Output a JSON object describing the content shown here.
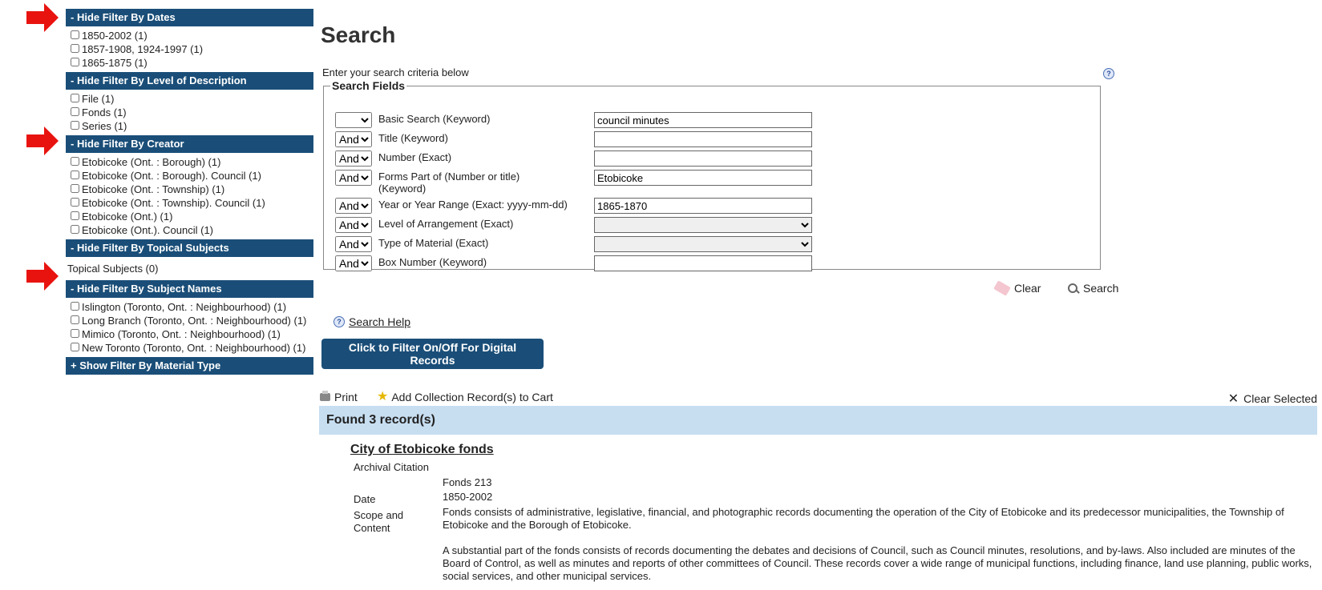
{
  "filters": {
    "dates": {
      "header": "- Hide Filter By Dates",
      "items": [
        "1850-2002 (1)",
        "1857-1908, 1924-1997 (1)",
        "1865-1875 (1)"
      ]
    },
    "level": {
      "header": "- Hide Filter By Level of Description",
      "items": [
        "File (1)",
        "Fonds (1)",
        "Series (1)"
      ]
    },
    "creator": {
      "header": "- Hide Filter By Creator",
      "items": [
        "Etobicoke (Ont. : Borough) (1)",
        "Etobicoke (Ont. : Borough). Council (1)",
        "Etobicoke (Ont. : Township) (1)",
        "Etobicoke (Ont. : Township). Council (1)",
        "Etobicoke (Ont.) (1)",
        "Etobicoke (Ont.). Council (1)"
      ]
    },
    "topical": {
      "header": "- Hide Filter By Topical Subjects",
      "text": "Topical Subjects (0)"
    },
    "subject_names": {
      "header": "- Hide Filter By Subject Names",
      "items": [
        "Islington (Toronto, Ont. : Neighbourhood) (1)",
        "Long Branch (Toronto, Ont. : Neighbourhood) (1)",
        "Mimico (Toronto, Ont. : Neighbourhood) (1)",
        "New Toronto (Toronto, Ont. : Neighbourhood) (1)"
      ]
    },
    "material": {
      "header": "+ Show Filter By Material Type"
    }
  },
  "search": {
    "title": "Search",
    "criteria_text": "Enter your search criteria below",
    "help_icon": "question-circle-icon",
    "legend": "Search Fields",
    "rows": [
      {
        "op": "",
        "label": "Basic Search  (Keyword)",
        "value": "council minutes",
        "type": "text"
      },
      {
        "op": "And",
        "label": "Title  (Keyword)",
        "value": "",
        "type": "text"
      },
      {
        "op": "And",
        "label": "Number  (Exact)",
        "value": "",
        "type": "text"
      },
      {
        "op": "And",
        "label": "Forms Part of (Number or title) (Keyword)",
        "value": "Etobicoke",
        "type": "text"
      },
      {
        "op": "And",
        "label": "Year or Year Range  (Exact: yyyy-mm-dd)",
        "value": "1865-1870",
        "type": "text"
      },
      {
        "op": "And",
        "label": "Level of Arrangement  (Exact)",
        "value": "",
        "type": "select"
      },
      {
        "op": "And",
        "label": "Type of Material  (Exact)",
        "value": "",
        "type": "select"
      },
      {
        "op": "And",
        "label": "Box Number  (Keyword)",
        "value": "",
        "type": "text"
      }
    ],
    "clear_label": "Clear",
    "search_label": "Search",
    "search_help_label": "Search Help",
    "digital_button": "Click to Filter On/Off For Digital Records"
  },
  "toolbar": {
    "print_label": "Print",
    "add_cart_label": "Add Collection Record(s) to Cart",
    "clear_selected_label": "Clear Selected"
  },
  "results": {
    "found_text": "Found 3 record(s)",
    "record": {
      "title": "City of Etobicoke fonds",
      "citation_label": "Archival Citation",
      "citation_value": "Fonds 213",
      "date_label": "Date",
      "date_value": "1850-2002",
      "scope_label": "Scope and Content",
      "scope_p1": "Fonds consists of administrative, legislative, financial, and photographic records documenting the operation of the City of Etobicoke and its predecessor municipalities, the Township of Etobicoke and the Borough of Etobicoke.",
      "scope_p2": "A substantial part of the fonds consists of records documenting the debates and decisions of Council, such as Council minutes, resolutions, and by-laws. Also included are minutes of the Board of Control, as well as minutes and reports of other committees of Council. These records cover a wide range of municipal functions, including finance, land use planning, public works, social services, and other municipal services."
    }
  },
  "colors": {
    "filter_header_bg": "#1a4e78",
    "found_bar_bg": "#c7def1",
    "arrow": "#e8130f"
  }
}
